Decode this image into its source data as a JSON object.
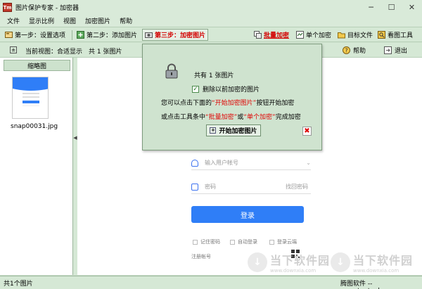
{
  "window": {
    "title": "图片保护专家 - 加密器",
    "icon_label": "Tm",
    "min": "─",
    "max": "☐",
    "close": "✕"
  },
  "menu": {
    "items": [
      "文件",
      "显示比例",
      "视图",
      "加密图片",
      "帮助"
    ]
  },
  "toolbar": {
    "step1": "第一步：设置选项",
    "step2": "第二步：添加图片",
    "step3": "第三步：加密图片",
    "batch": "批量加密",
    "single": "单个加密",
    "target": "目标文件",
    "viewer": "看图工具"
  },
  "viewbar": {
    "icon": "±",
    "current_view": "当前视图：合适显示　共 1 张图片",
    "help": "帮助",
    "exit": "退出"
  },
  "thumbnails": {
    "header": "缩略图",
    "filename": "snap00031.jpg"
  },
  "preview": {
    "account_placeholder": "输入用户帐号",
    "password_placeholder": "密码",
    "find_password": "找回密码",
    "login": "登录",
    "remember": "记住密码",
    "auto_login": "自动登录",
    "cloud": "登录云端",
    "register": "注册帐号",
    "watermark_cn": "当下软件园",
    "watermark_url": "www.downxia.com"
  },
  "popup": {
    "count": "共有 1 张图片",
    "delete_old": "删除以前加密的图片",
    "instr1_a": "您可以点击下面的",
    "instr1_b": "“开始加密图片”",
    "instr1_c": "按钮开始加密",
    "instr2_a": "或点击工具条中",
    "instr2_b": "“批量加密”",
    "instr2_c": "或",
    "instr2_d": "“单个加密”",
    "instr2_e": "完成加密",
    "start": "开始加密图片",
    "close": "✖"
  },
  "status": {
    "left": "共1个图片",
    "right": "腾图软件 -- www.tontool.com"
  },
  "colors": {
    "accent_red": "#e00000",
    "panel_green": "#cfe3cf",
    "login_blue": "#2f7ef7"
  }
}
